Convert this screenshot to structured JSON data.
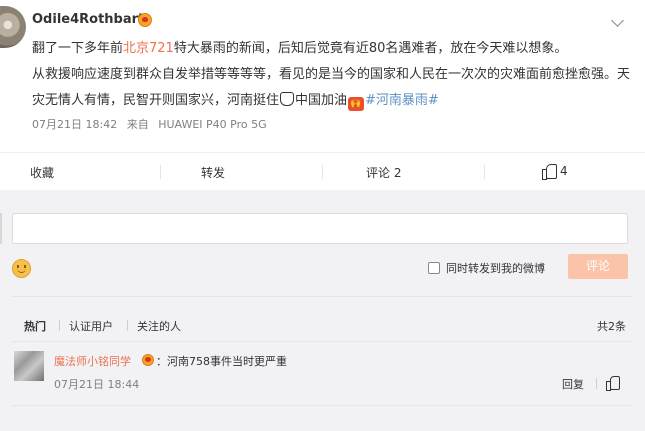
{
  "post": {
    "username": "Odile4Rothbart",
    "text_part1": "翻了一下多年前",
    "text_link": "北京721",
    "text_part2": "特大暴雨的新闻，后知后觉竟有近80名遇难者，放在今天难以想象。",
    "text_part3": "从救援响应速度到群众自发举措等等等等，看见的是当今的国家和人民在一次次的灾难面前愈挫愈强。天灾无情人有情，民智开则国家兴，河南挺住",
    "text_part4": "中国加油",
    "hashtag": "#河南暴雨#",
    "date": "07月21日 18:42",
    "source_prefix": "来自",
    "device": "HUAWEI P40 Pro 5G"
  },
  "actions": {
    "favorite": "收藏",
    "repost": "转发",
    "comment": "评论 2",
    "like_count": "4"
  },
  "comment_form": {
    "repost_label": "同时转发到我的微博",
    "submit_label": "评论"
  },
  "filters": {
    "tabs": [
      "热门",
      "认证用户",
      "关注的人"
    ],
    "total": "共2条"
  },
  "comments": [
    {
      "name": "魔法师小铭同学",
      "text": "：河南758事件当时更严重",
      "time": "07月21日 18:44",
      "reply_label": "回复"
    }
  ],
  "colors": {
    "link": "#eb7350",
    "hashtag": "#5d91c4",
    "submit_bg": "#fbc4a9",
    "comment_bg": "#f2f2f5"
  }
}
